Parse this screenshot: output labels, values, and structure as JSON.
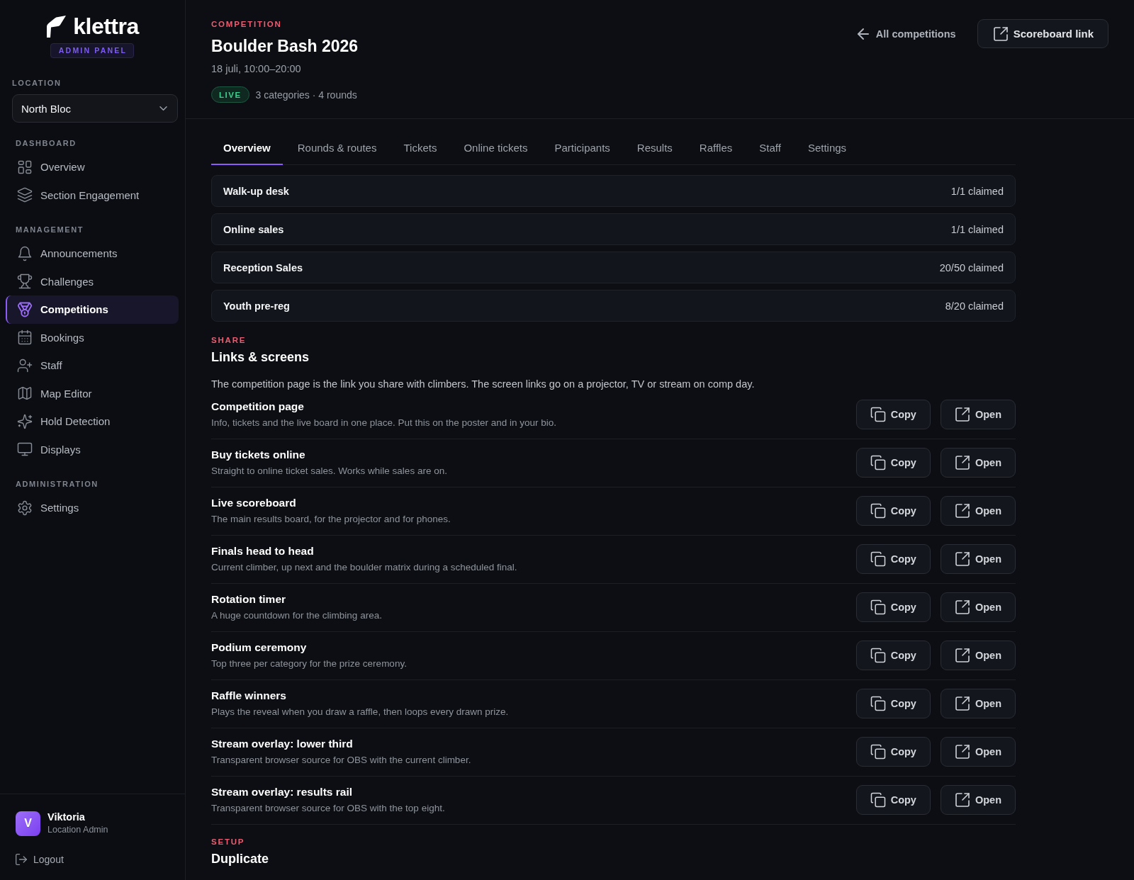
{
  "sidebar": {
    "brand": {
      "name": "klettra",
      "badge": "ADMIN PANEL"
    },
    "location": {
      "label": "LOCATION",
      "value": "North Bloc"
    },
    "sections": [
      {
        "heading": "DASHBOARD",
        "items": [
          {
            "label": "Overview",
            "selected": false
          },
          {
            "label": "Section Engagement",
            "selected": false
          }
        ]
      },
      {
        "heading": "MANAGEMENT",
        "items": [
          {
            "label": "Announcements",
            "selected": false
          },
          {
            "label": "Challenges",
            "selected": false
          },
          {
            "label": "Competitions",
            "selected": true
          },
          {
            "label": "Bookings",
            "selected": false
          },
          {
            "label": "Staff",
            "selected": false
          },
          {
            "label": "Map Editor",
            "selected": false
          },
          {
            "label": "Hold Detection",
            "selected": false
          },
          {
            "label": "Displays",
            "selected": false
          }
        ]
      },
      {
        "heading": "ADMINISTRATION",
        "items": [
          {
            "label": "Settings",
            "selected": false
          }
        ]
      }
    ],
    "user": {
      "initial": "V",
      "name": "Viktoria",
      "role": "Location Admin"
    },
    "logout": "Logout"
  },
  "header": {
    "eyebrow": "COMPETITION",
    "title": "Boulder Bash 2026",
    "date": "18 juli, 10:00–20:00",
    "status": "LIVE",
    "summary": "3 categories · 4 rounds",
    "back_link": "All competitions",
    "scoreboard_button": "Scoreboard link"
  },
  "tabs": [
    {
      "label": "Overview",
      "selected": true
    },
    {
      "label": "Rounds & routes",
      "selected": false
    },
    {
      "label": "Tickets",
      "selected": false
    },
    {
      "label": "Online tickets",
      "selected": false
    },
    {
      "label": "Participants",
      "selected": false
    },
    {
      "label": "Results",
      "selected": false
    },
    {
      "label": "Raffles",
      "selected": false
    },
    {
      "label": "Staff",
      "selected": false
    },
    {
      "label": "Settings",
      "selected": false
    }
  ],
  "tickets": [
    {
      "name": "Walk-up desk",
      "claimed": "1/1 claimed"
    },
    {
      "name": "Online sales",
      "claimed": "1/1 claimed"
    },
    {
      "name": "Reception Sales",
      "claimed": "20/50 claimed"
    },
    {
      "name": "Youth pre-reg",
      "claimed": "8/20 claimed"
    }
  ],
  "share": {
    "eyebrow": "SHARE",
    "title": "Links & screens",
    "description": "The competition page is the link you share with climbers. The screen links go on a projector, TV or stream on comp day.",
    "links": [
      {
        "title": "Competition page",
        "description": "Info, tickets and the live board in one place. Put this on the poster and in your bio.",
        "copy": "Copy",
        "open": "Open"
      },
      {
        "title": "Buy tickets online",
        "description": "Straight to online ticket sales. Works while sales are on.",
        "copy": "Copy",
        "open": "Open"
      },
      {
        "title": "Live scoreboard",
        "description": "The main results board, for the projector and for phones.",
        "copy": "Copy",
        "open": "Open"
      },
      {
        "title": "Finals head to head",
        "description": "Current climber, up next and the boulder matrix during a scheduled final.",
        "copy": "Copy",
        "open": "Open"
      },
      {
        "title": "Rotation timer",
        "description": "A huge countdown for the climbing area.",
        "copy": "Copy",
        "open": "Open"
      },
      {
        "title": "Podium ceremony",
        "description": "Top three per category for the prize ceremony.",
        "copy": "Copy",
        "open": "Open"
      },
      {
        "title": "Raffle winners",
        "description": "Plays the reveal when you draw a raffle, then loops every drawn prize.",
        "copy": "Copy",
        "open": "Open"
      },
      {
        "title": "Stream overlay: lower third",
        "description": "Transparent browser source for OBS with the current climber.",
        "copy": "Copy",
        "open": "Open"
      },
      {
        "title": "Stream overlay: results rail",
        "description": "Transparent browser source for OBS with the top eight.",
        "copy": "Copy",
        "open": "Open"
      }
    ]
  },
  "setup": {
    "eyebrow": "SETUP",
    "title": "Duplicate"
  }
}
